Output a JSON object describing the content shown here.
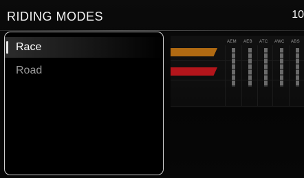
{
  "header": {
    "title": "RIDING MODES",
    "clock": "10"
  },
  "modes": {
    "items": [
      {
        "label": "Race",
        "selected": true
      },
      {
        "label": "Road",
        "selected": false
      }
    ]
  },
  "preview": {
    "columns": [
      "AEM",
      "AEB",
      "ATC",
      "AWC",
      "ABS"
    ],
    "band_colors": {
      "race": "#b06a12",
      "road": "#b3151b"
    }
  }
}
